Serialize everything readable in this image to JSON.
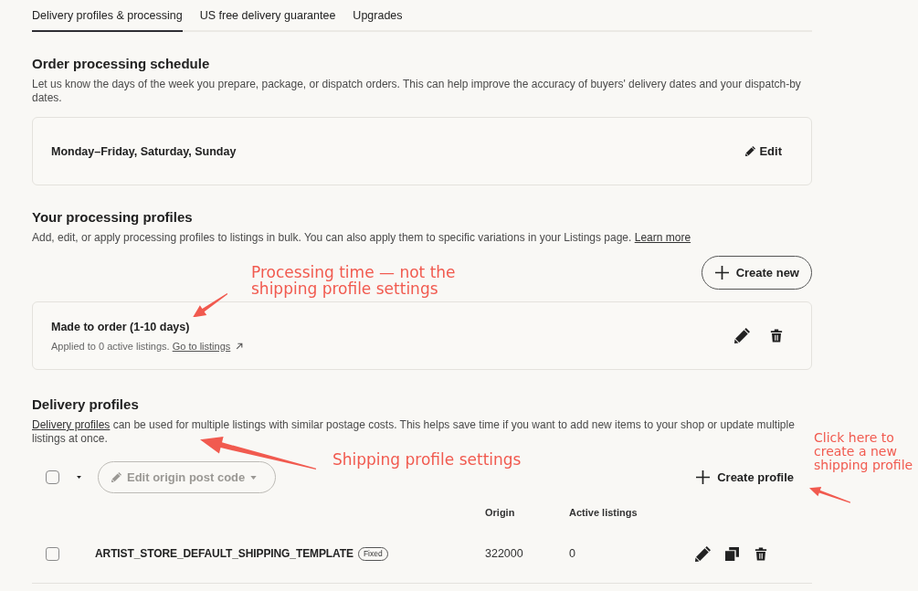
{
  "tabs": [
    {
      "label": "Delivery profiles & processing",
      "selected": true
    },
    {
      "label": "US free delivery guarantee",
      "selected": false
    },
    {
      "label": "Upgrades",
      "selected": false
    }
  ],
  "order_processing_schedule": {
    "title": "Order processing schedule",
    "description": "Let us know the days of the week you prepare, package, or dispatch orders. This can help improve the accuracy of buyers' delivery dates and your dispatch-by dates.",
    "schedule": "Monday–Friday, Saturday, Sunday",
    "edit_button": "Edit"
  },
  "processing_profiles": {
    "title": "Your processing profiles",
    "description": "Add, edit, or apply processing profiles to listings in bulk. You can also apply them to specific variations in your Listings page.",
    "learn_more_link": "Learn more",
    "create_button": "Create new",
    "profiles": [
      {
        "name": "Made to order (1-10 days)",
        "applied_text": "Applied to 0 active listings.",
        "listings_link": "Go to listings"
      }
    ]
  },
  "delivery_profiles": {
    "title": "Delivery profiles",
    "description_link": "Delivery profiles",
    "description": "can be used for multiple listings with similar postage costs. This helps save time if you want to add new items to your shop or update multiple listings at once.",
    "select_all": {
      "checked": false
    },
    "edit_origin_button": {
      "label": "Edit origin post code",
      "disabled": true
    },
    "create_button": "Create profile",
    "table": {
      "columns": [
        "Origin",
        "Active listings"
      ],
      "rows": [
        {
          "checked": false,
          "name": "ARTIST_STORE_DEFAULT_SHIPPING_TEMPLATE",
          "tag": "Fixed",
          "origin": "322000",
          "active_listings": "0"
        }
      ]
    }
  },
  "annotations": [
    {
      "text": "Processing time — not the\nshipping profile settings"
    },
    {
      "text": "Shipping profile settings"
    },
    {
      "text": "Click here to\ncreate a new\nshipping profile"
    }
  ]
}
